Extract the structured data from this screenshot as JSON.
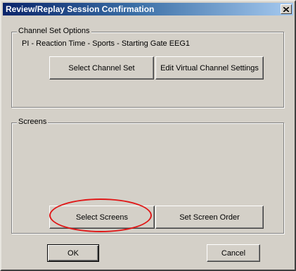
{
  "window": {
    "title": "Review/Replay Session Confirmation",
    "close_icon": "close-icon"
  },
  "channel_set": {
    "group_label": "Channel Set Options",
    "current_value": "PI - Reaction Time - Sports - Starting Gate EEG1",
    "select_button": "Select Channel Set",
    "edit_button": "Edit Virtual Channel Settings"
  },
  "screens": {
    "group_label": "Screens",
    "select_button": "Select Screens",
    "order_button": "Set Screen Order"
  },
  "footer": {
    "ok_button": "OK",
    "cancel_button": "Cancel"
  },
  "annotation": {
    "highlight_color": "#e01818",
    "highlight_target": "Select Screens"
  }
}
